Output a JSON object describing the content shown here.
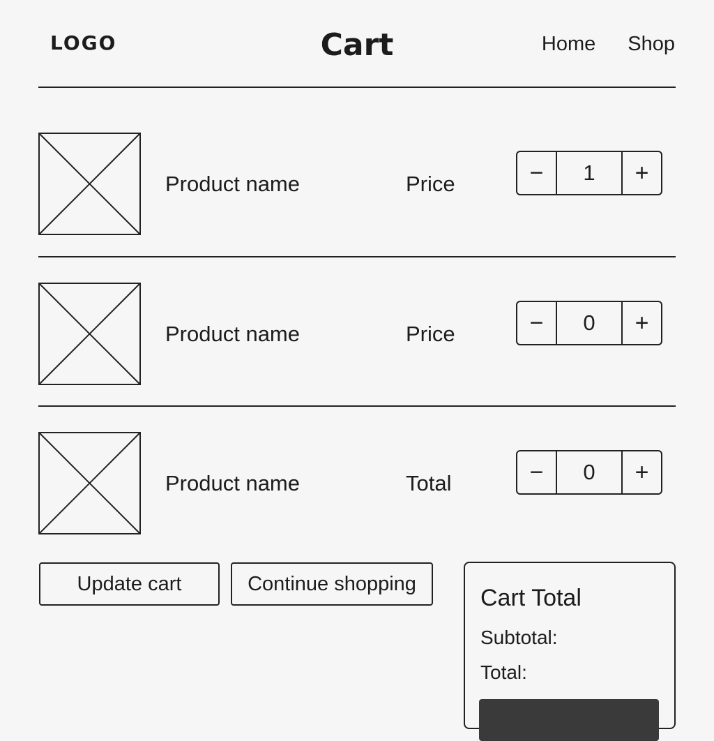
{
  "header": {
    "logo": "LOGO",
    "title": "Cart",
    "nav": [
      "Home",
      "Shop"
    ]
  },
  "cart": {
    "items": [
      {
        "name": "Product name",
        "price_label": "Price",
        "quantity": "1",
        "image_icon": "image-placeholder-icon"
      },
      {
        "name": "Product name",
        "price_label": "Price",
        "quantity": "0",
        "image_icon": "image-placeholder-icon"
      },
      {
        "name": "Product name",
        "price_label": "Total",
        "quantity": "0",
        "image_icon": "image-placeholder-icon"
      }
    ],
    "decrement_symbol": "−",
    "increment_symbol": "+"
  },
  "actions": {
    "update_cart": "Update cart",
    "continue_shopping": "Continue shopping"
  },
  "summary": {
    "title": "Cart Total",
    "subtotal_label": "Subtotal:",
    "total_label": "Total:"
  },
  "colors": {
    "background": "#f6f6f6",
    "line": "#222222",
    "checkout_button": "#3a3a3a"
  }
}
